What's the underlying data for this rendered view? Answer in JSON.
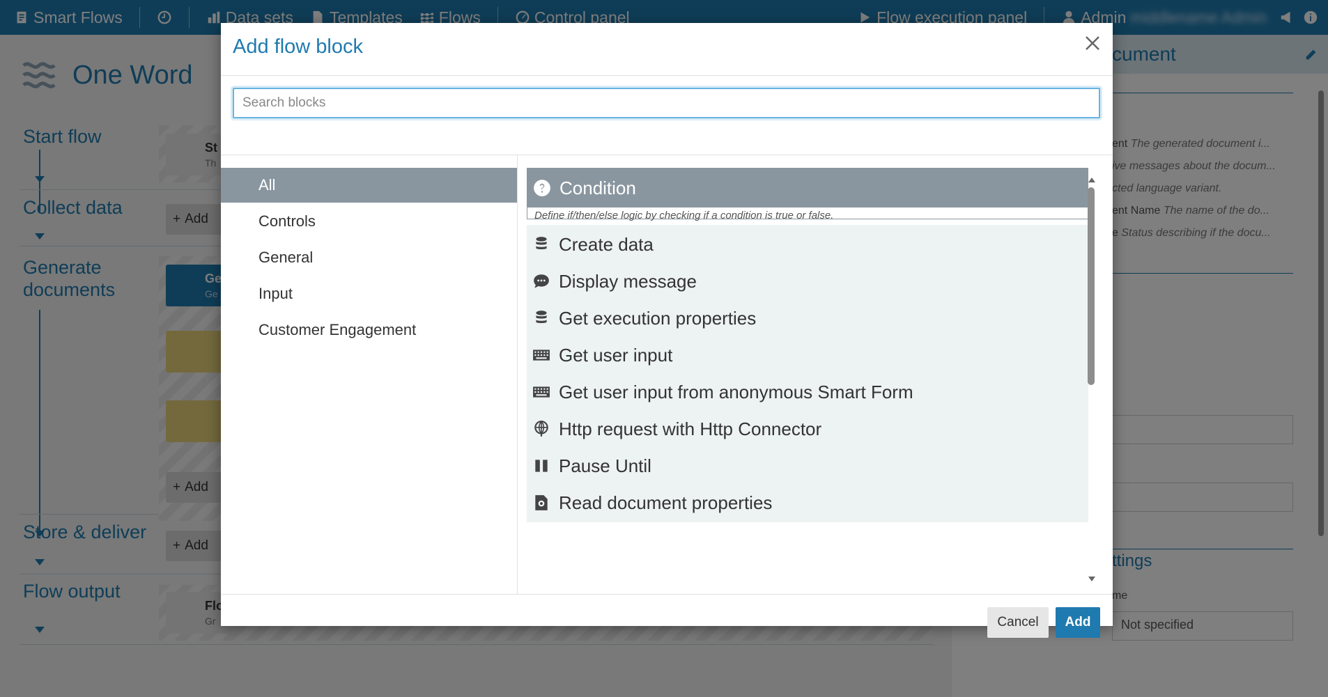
{
  "nav": {
    "app_name": "Smart Flows",
    "data_sets": "Data sets",
    "templates": "Templates",
    "flows": "Flows",
    "control_panel": "Control panel",
    "flow_execution_panel": "Flow execution panel",
    "user": "Admin",
    "user_blurred": "middlename Admin"
  },
  "flow": {
    "title": "One Word",
    "phases": {
      "start": "Start flow",
      "collect": "Collect data",
      "generate": "Generate documents",
      "store": "Store & deliver",
      "output": "Flow output"
    },
    "add_label": "Add",
    "block_start_label": "St",
    "block_start_sub": "Th",
    "block_generate_label": "Ge",
    "block_generate_sub": "Ge",
    "block_output_label": "Flo",
    "block_output_sub": "Gr"
  },
  "right_panel": {
    "title": "cument",
    "rows": [
      {
        "label": "ent",
        "desc": "The generated document i..."
      },
      {
        "label": "",
        "desc": "ive messages about the docum..."
      },
      {
        "label": "",
        "desc": "cted language variant."
      },
      {
        "label": "ent Name",
        "desc": "The name of the do..."
      },
      {
        "label": "e",
        "desc": "Status describing if the docu..."
      }
    ],
    "settings_title": "ttings",
    "name_label": "me",
    "not_specified": "Not specified"
  },
  "modal": {
    "title": "Add flow block",
    "search_placeholder": "Search blocks",
    "search_value": "",
    "categories": [
      "All",
      "Controls",
      "General",
      "Input",
      "Customer Engagement"
    ],
    "active_category": "All",
    "blocks": [
      {
        "name": "Condition",
        "icon": "question-circle-icon",
        "description": "Define if/then/else logic by checking if a condition is true or false."
      },
      {
        "name": "Create data",
        "icon": "database-icon"
      },
      {
        "name": "Display message",
        "icon": "comment-icon"
      },
      {
        "name": "Get execution properties",
        "icon": "database-icon"
      },
      {
        "name": "Get user input",
        "icon": "keyboard-icon"
      },
      {
        "name": "Get user input from anonymous Smart Form",
        "icon": "keyboard-icon"
      },
      {
        "name": "Http request with Http Connector",
        "icon": "globe-icon"
      },
      {
        "name": "Pause Until",
        "icon": "pause-icon"
      },
      {
        "name": "Read document properties",
        "icon": "file-gear-icon"
      }
    ],
    "cancel_label": "Cancel",
    "add_label": "Add"
  },
  "colors": {
    "brand": "#1f7aaf",
    "selected_block": "#8a969f",
    "block_bg": "#edf2f2"
  }
}
